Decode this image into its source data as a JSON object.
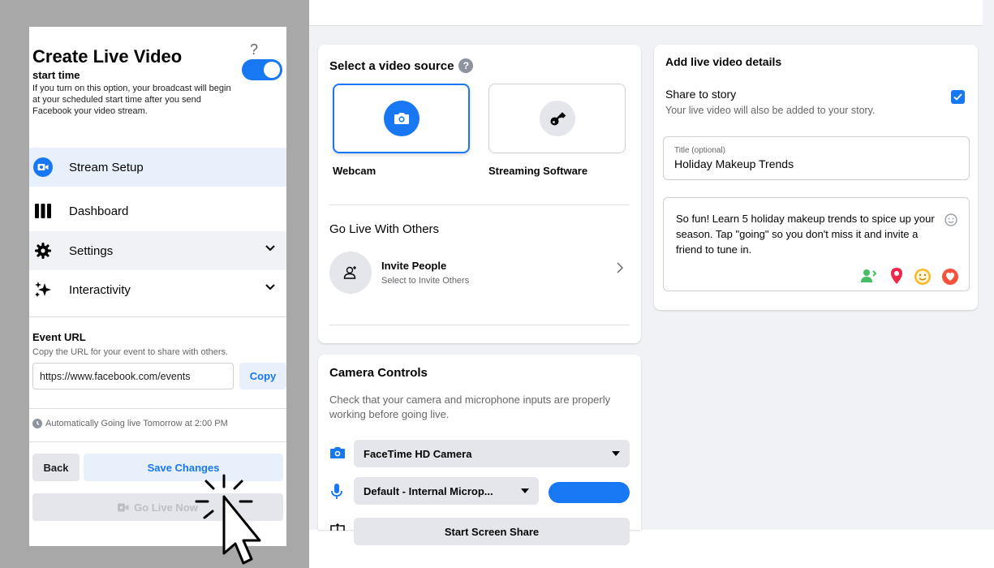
{
  "left_panel": {
    "title": "Create Live Video",
    "help": "?",
    "start_time_label": "start time",
    "start_time_desc": "If you turn on this option, your broadcast will begin at your scheduled start time after you send Facebook your video stream.",
    "nav": [
      {
        "label": "Stream Setup",
        "icon": "camera-icon",
        "active": true
      },
      {
        "label": "Dashboard",
        "icon": "dashboard-icon"
      },
      {
        "label": "Settings",
        "icon": "gear-icon"
      },
      {
        "label": "Interactivity",
        "icon": "sparkle-icon"
      }
    ],
    "event_url_heading": "Event URL",
    "event_url_desc": "Copy the URL for your event to share with others.",
    "event_url_value": "https://www.facebook.com/events",
    "copy_label": "Copy",
    "auto_live_text": "Automatically Going live Tomorrow at 2:00 PM",
    "back_label": "Back",
    "save_label": "Save Changes",
    "go_live_label": "Go Live Now"
  },
  "source_card": {
    "title": "Select a video source",
    "options": [
      {
        "label": "Webcam",
        "icon": "camera-icon",
        "selected": true
      },
      {
        "label": "Streaming Software",
        "icon": "key-icon",
        "selected": false
      }
    ],
    "go_live_with_others": "Go Live With Others",
    "invite_title": "Invite People",
    "invite_subtitle": "Select to Invite Others"
  },
  "camera_card": {
    "title": "Camera Controls",
    "description": "Check that your camera and microphone inputs are properly working before going live.",
    "camera_value": "FaceTime HD Camera",
    "mic_value": "Default - Internal Microp...",
    "screen_share_label": "Start Screen Share"
  },
  "details_card": {
    "title": "Add live video details",
    "share_story_label": "Share to story",
    "share_story_desc": "Your live video will also be added to your story.",
    "share_story_checked": true,
    "title_field_label": "Title (optional)",
    "title_field_value": "Holiday Makeup Trends",
    "description_value": "So fun! Learn 5 holiday makeup trends to spice up your season. Tap \"going\" so you don't miss it and invite a friend to tune in."
  },
  "colors": {
    "accent": "#1877f2",
    "background": "#f0f2f5",
    "frame": "#a8a8a8"
  }
}
